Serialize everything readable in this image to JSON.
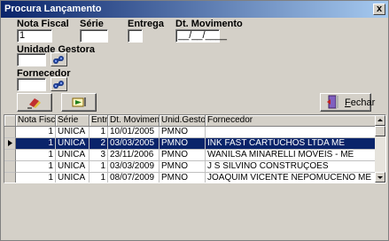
{
  "window": {
    "title": "Procura Lançamento",
    "close_glyph": "x"
  },
  "filters": {
    "nota_fiscal": {
      "label": "Nota Fiscal",
      "value": "1"
    },
    "serie": {
      "label": "Série",
      "value": ""
    },
    "entrega": {
      "label": "Entrega",
      "value": ""
    },
    "dt_movimento": {
      "label": "Dt. Movimento",
      "value": "__/__/____"
    },
    "unidade_gestora": {
      "label": "Unidade Gestora",
      "value": ""
    },
    "fornecedor": {
      "label": "Fornecedor",
      "value": ""
    }
  },
  "toolbar": {
    "clear_icon": "eraser-icon",
    "search_icon": "search-arrow-icon",
    "close_label_prefix": "",
    "close_label_underlined": "F",
    "close_label_rest": "echar",
    "close_icon": "door-exit-icon"
  },
  "grid": {
    "columns": [
      "Nota Fiscal",
      "Série",
      "Entr.",
      "Dt. Movimento",
      "Unid.Gestora",
      "Fornecedor"
    ],
    "rows": [
      {
        "nota_fiscal": "1",
        "serie": "UNICA",
        "entr": "1",
        "dt_movimento": "10/01/2005",
        "unid_gestora": "PMNO",
        "fornecedor": "",
        "selected": false
      },
      {
        "nota_fiscal": "1",
        "serie": "UNICA",
        "entr": "2",
        "dt_movimento": "03/03/2005",
        "unid_gestora": "PMNO",
        "fornecedor": "INK FAST CARTUCHOS LTDA ME",
        "selected": true
      },
      {
        "nota_fiscal": "1",
        "serie": "UNICA",
        "entr": "3",
        "dt_movimento": "23/11/2006",
        "unid_gestora": "PMNO",
        "fornecedor": "WANILSA MINARELLI MOVEIS - ME",
        "selected": false
      },
      {
        "nota_fiscal": "1",
        "serie": "UNICA",
        "entr": "1",
        "dt_movimento": "03/03/2009",
        "unid_gestora": "PMNO",
        "fornecedor": "J S SILVINO CONSTRUÇOES",
        "selected": false
      },
      {
        "nota_fiscal": "1",
        "serie": "UNICA",
        "entr": "1",
        "dt_movimento": "08/07/2009",
        "unid_gestora": "PMNO",
        "fornecedor": "JOAQUIM VICENTE NEPOMUCENO ME",
        "selected": false
      }
    ]
  }
}
